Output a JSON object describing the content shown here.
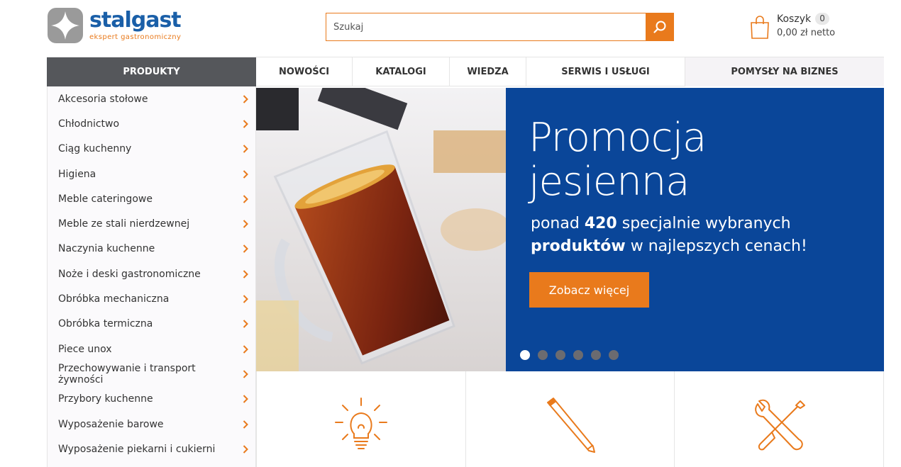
{
  "brand": {
    "name": "stalgast",
    "tagline": "ekspert gastronomiczny"
  },
  "search": {
    "placeholder": "Szukaj"
  },
  "cart": {
    "title": "Koszyk",
    "count": "0",
    "total": "0,00 zł netto"
  },
  "nav": {
    "products": "PRODUKTY",
    "items": [
      "NOWOŚCI",
      "KATALOGI",
      "WIEDZA",
      "SERWIS I USŁUGI",
      "POMYSŁY NA BIZNES"
    ]
  },
  "categories": [
    "Akcesoria stołowe",
    "Chłodnictwo",
    "Ciąg kuchenny",
    "Higiena",
    "Meble cateringowe",
    "Meble ze stali nierdzewnej",
    "Naczynia kuchenne",
    "Noże i deski gastronomiczne",
    "Obróbka mechaniczna",
    "Obróbka termiczna",
    "Piece unox",
    "Przechowywanie i transport żywności",
    "Przybory kuchenne",
    "Wyposażenie barowe",
    "Wyposażenie piekarni i cukierni"
  ],
  "banner": {
    "title_line1": "Promocja",
    "title_line2": "jesienna",
    "sub_1a": "ponad ",
    "sub_1b": "420",
    "sub_1c": " specjalnie wybranych",
    "sub_2a": "produktów",
    "sub_2b": " w najlepszych cenach!",
    "cta": "Zobacz więcej",
    "slides": 6,
    "active_slide": 1
  },
  "colors": {
    "accent": "#e97a1c",
    "brand_blue": "#1a5fa8",
    "banner_blue": "#0a4699",
    "nav_dark": "#55575b"
  },
  "tiles": [
    {
      "icon": "lightbulb-icon"
    },
    {
      "icon": "pencil-icon"
    },
    {
      "icon": "tools-icon"
    }
  ]
}
